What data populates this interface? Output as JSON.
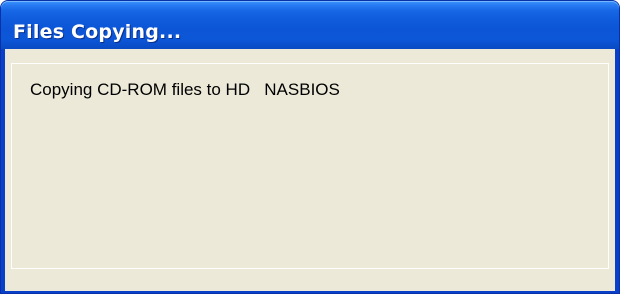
{
  "window": {
    "title": "Files Copying..."
  },
  "dialog": {
    "message": "Copying CD-ROM files to HD   NASBIOS"
  },
  "colors": {
    "titlebar": "#0b55d6",
    "client_background": "#ece9d8",
    "title_text": "#ffffff"
  }
}
